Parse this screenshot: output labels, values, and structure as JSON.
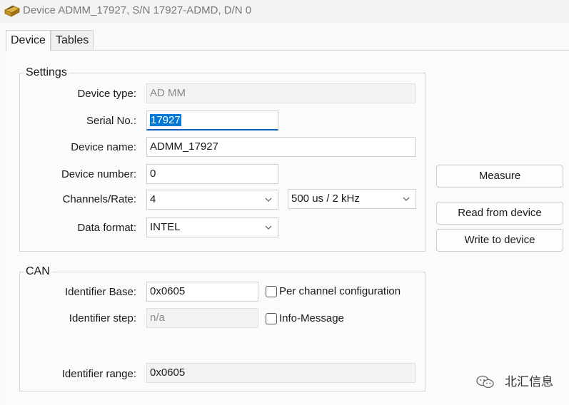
{
  "window": {
    "title": "Device ADMM_17927, S/N 17927-ADMD, D/N 0"
  },
  "tabs": [
    {
      "label": "Device",
      "active": true
    },
    {
      "label": "Tables",
      "active": false
    }
  ],
  "settings": {
    "title": "Settings",
    "device_type": {
      "label": "Device type:",
      "value": "AD MM"
    },
    "serial_no": {
      "label": "Serial No.:",
      "value": "17927"
    },
    "device_name": {
      "label": "Device name:",
      "value": "ADMM_17927"
    },
    "device_number": {
      "label": "Device number:",
      "value": "0"
    },
    "channels_rate": {
      "label": "Channels/Rate:",
      "channels": "4",
      "rate": "500 us / 2 kHz"
    },
    "data_format": {
      "label": "Data format:",
      "value": "INTEL"
    }
  },
  "buttons": {
    "measure": "Measure",
    "read_from_device": "Read from device",
    "write_to_device": "Write to device"
  },
  "can": {
    "title": "CAN",
    "identifier_base": {
      "label": "Identifier Base:",
      "value": "0x0605"
    },
    "identifier_step": {
      "label": "Identifier step:",
      "value": "n/a"
    },
    "identifier_range": {
      "label": "Identifier range:",
      "value": "0x0605"
    },
    "per_channel_configuration": {
      "label": "Per channel configuration",
      "checked": false
    },
    "info_message": {
      "label": "Info-Message",
      "checked": false
    }
  },
  "watermark": {
    "text": "北汇信息"
  },
  "colors": {
    "accent": "#005fb8",
    "selection": "#0078d7"
  }
}
